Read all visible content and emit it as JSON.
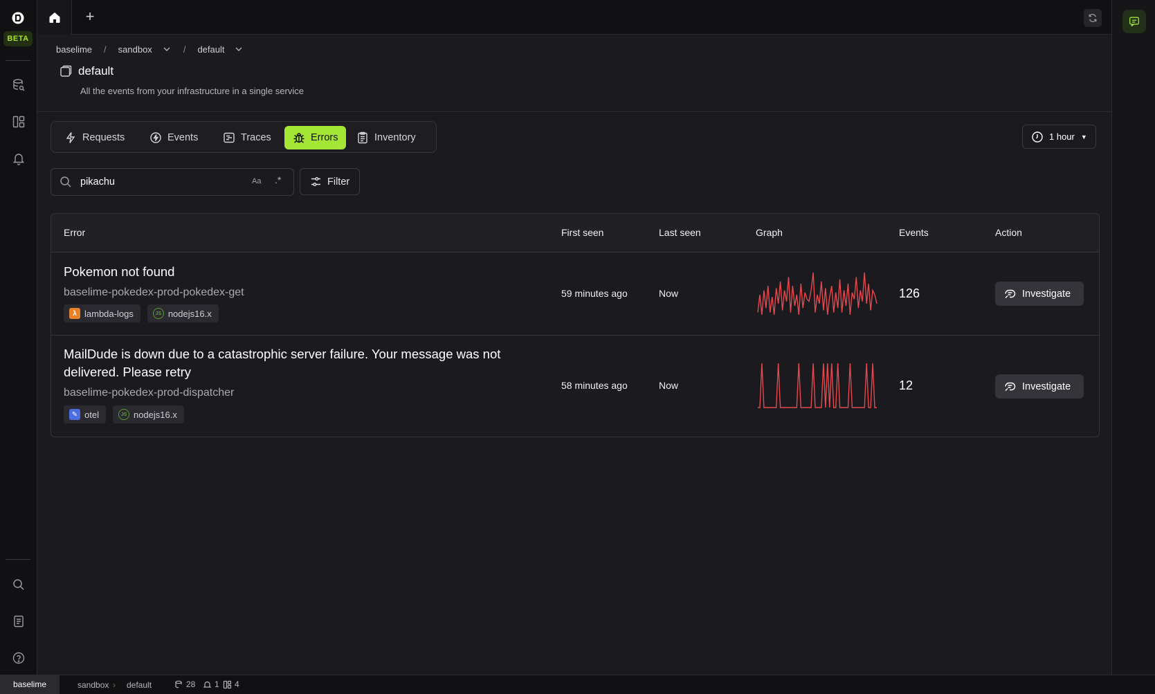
{
  "sidebar": {
    "beta_label": "BETA",
    "icons": [
      "datasets-icon",
      "dashboards-icon",
      "alerts-icon",
      "search-icon",
      "docs-icon",
      "help-icon"
    ]
  },
  "topbar": {
    "add_tab_label": "+"
  },
  "breadcrumb": {
    "org": "baselime",
    "environment": "sandbox",
    "service": "default"
  },
  "service": {
    "name": "default",
    "description": "All the events from your infrastructure in a single service"
  },
  "tabs": [
    {
      "label": "Requests"
    },
    {
      "label": "Events"
    },
    {
      "label": "Traces"
    },
    {
      "label": "Errors"
    },
    {
      "label": "Inventory"
    }
  ],
  "active_tab": "Errors",
  "time_range": {
    "label": "1 hour"
  },
  "search": {
    "value": "pikachu",
    "case_toggle_label": "Aa",
    "regex_toggle_label": ".*"
  },
  "filter_label": "Filter",
  "table": {
    "headers": {
      "error": "Error",
      "first_seen": "First seen",
      "last_seen": "Last seen",
      "graph": "Graph",
      "events": "Events",
      "action": "Action"
    },
    "rows": [
      {
        "title": "Pokemon not found",
        "service": "baselime-pokedex-prod-pokedex-get",
        "tags": [
          {
            "icon": "aws-lambda-icon",
            "label": "lambda-logs"
          },
          {
            "icon": "nodejs-icon",
            "label": "nodejs16.x"
          }
        ],
        "first_seen": "59 minutes ago",
        "last_seen": "Now",
        "events": "126",
        "action": "Investigate",
        "graph": [
          0.1,
          0.5,
          0.05,
          0.6,
          0.2,
          0.7,
          0.1,
          0.45,
          0.05,
          0.65,
          0.3,
          0.8,
          0.15,
          0.6,
          0.35,
          0.9,
          0.1,
          0.7,
          0.25,
          0.5,
          0.05,
          0.75,
          0.2,
          0.55,
          0.4,
          0.35,
          0.6,
          1.0,
          0.1,
          0.5,
          0.3,
          0.8,
          0.15,
          0.65,
          0.05,
          0.45,
          0.7,
          0.1,
          0.55,
          0.2,
          0.85,
          0.1,
          0.6,
          0.25,
          0.75,
          0.05,
          0.55,
          0.4,
          0.9,
          0.2,
          0.6,
          0.35,
          1.0,
          0.3,
          0.75,
          0.15,
          0.6,
          0.5,
          0.3
        ]
      },
      {
        "title": "MailDude is down due to a catastrophic server failure. Your message was not delivered. Please retry",
        "service": "baselime-pokedex-prod-dispatcher",
        "tags": [
          {
            "icon": "otel-icon",
            "label": "otel"
          },
          {
            "icon": "nodejs-icon",
            "label": "nodejs16.x"
          }
        ],
        "first_seen": "58 minutes ago",
        "last_seen": "Now",
        "events": "12",
        "action": "Investigate",
        "graph": [
          0,
          0,
          1,
          0,
          0,
          0,
          0,
          0,
          0,
          0,
          1,
          0,
          0,
          0,
          0,
          0,
          0,
          0,
          0,
          0,
          1,
          0,
          0,
          0,
          0,
          0,
          0,
          1,
          0,
          0,
          0,
          0,
          1,
          0,
          1,
          0,
          1,
          0,
          0,
          1,
          0,
          0,
          0,
          0,
          0,
          1,
          0,
          0,
          0,
          0,
          0,
          0,
          0,
          1,
          0,
          0,
          1,
          0,
          0
        ]
      }
    ]
  },
  "statusbar": {
    "environment_badge": "baselime",
    "env": "sandbox",
    "service": "default",
    "datasets_count": "28",
    "alerts_count": "1",
    "dashboards_count": "4"
  },
  "colors": {
    "accent": "#a3e635",
    "graph_line": "#e5484d",
    "background": "#1b1b1f"
  }
}
